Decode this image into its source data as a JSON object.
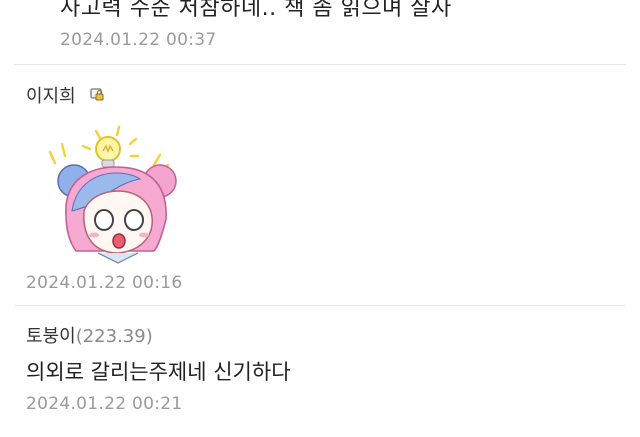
{
  "comments": [
    {
      "text": "사고력 수준 처참하네.. 책 좀 읽으며 살자",
      "date": "2024.01.22 00:37"
    },
    {
      "author": "이지희",
      "icon": "lock-icon",
      "sticker": "lightbulb-girl-sticker",
      "date": "2024.01.22 00:16"
    },
    {
      "author": "토붕이",
      "score": "(223.39)",
      "text": "의외로 갈리는주제네 신기하다",
      "date": "2024.01.22 00:21"
    }
  ]
}
